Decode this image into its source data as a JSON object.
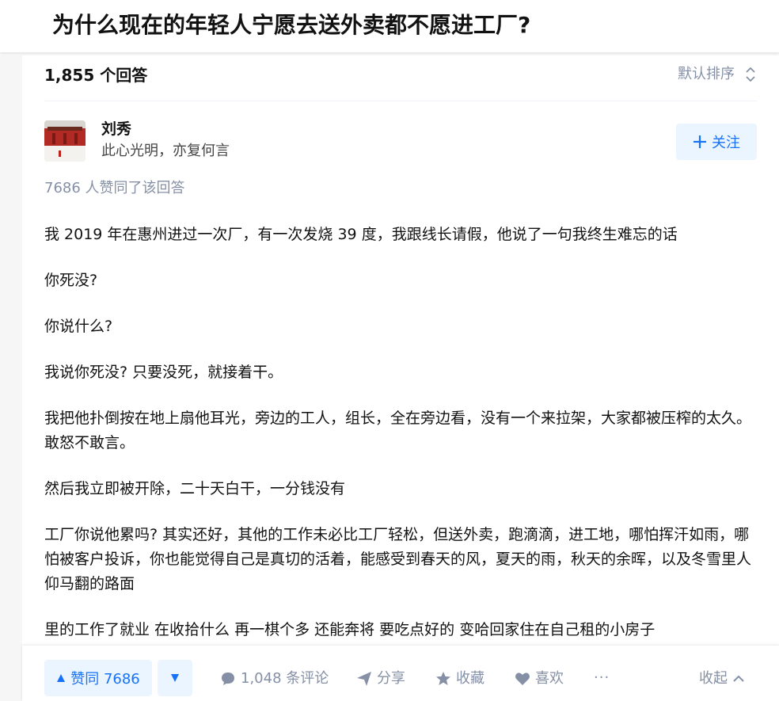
{
  "question": {
    "title": "为什么现在的年轻人宁愿去送外卖都不愿进工厂?"
  },
  "list_header": {
    "answer_count": "1,855 个回答",
    "sort_label": "默认排序"
  },
  "author": {
    "name": "刘秀",
    "bio": "此心光明，亦复何言",
    "follow_label": "关注",
    "avatar_icon": "avatar-photo-red-palace-snow"
  },
  "answer": {
    "upvote_summary": "7686 人赞同了该回答",
    "paragraphs": [
      "我 2019 年在惠州进过一次厂，有一次发烧 39 度，我跟线长请假，他说了一句我终生难忘的话",
      "你死没?",
      "你说什么?",
      "我说你死没? 只要没死，就接着干。",
      "我把他扑倒按在地上扇他耳光，旁边的工人，组长，全在旁边看，没有一个来拉架，大家都被压榨的太久。敢怒不敢言。",
      "然后我立即被开除，二十天白干，一分钱没有",
      "工厂你说他累吗? 其实还好，其他的工作未必比工厂轻松，但送外卖，跑滴滴，进工地，哪怕挥汗如雨，哪怕被客户投诉，你也能觉得自己是真切的活着，能感受到春天的风，夏天的雨，秋天的余晖，以及冬雪里人仰马翻的路面",
      "里的工作了就业 在收拾什么 再一棋个多 还能奔将 要吃点好的 变哈回家住在自己租的小房子"
    ]
  },
  "actions": {
    "vote_up_label": "赞同 7686",
    "comments_label": "1,048 条评论",
    "share_label": "分享",
    "favorite_label": "收藏",
    "like_label": "喜欢",
    "more_label": "···",
    "collapse_label": "收起"
  },
  "colors": {
    "brand_blue": "#1772f6",
    "brand_blue_bg": "#ebf5ff",
    "muted": "#8590a6",
    "text": "#121212"
  }
}
